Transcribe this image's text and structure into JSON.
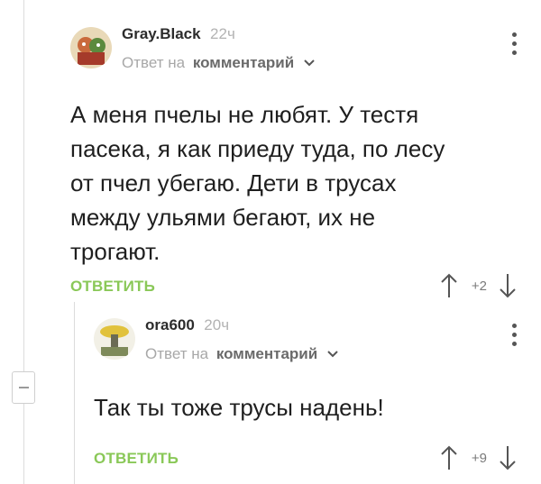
{
  "comments": [
    {
      "author": "Gray.Black",
      "time": "22ч",
      "reply_label": "Ответ на",
      "reply_link": "комментарий",
      "text": "А меня пчелы не любят. У тестя пасека, я как приеду туда, по лесу от пчел убегаю. Дети в трусах между ульями бегают, их не трогают.",
      "reply_button": "ОТВЕТИТЬ",
      "score": "+2"
    },
    {
      "author": "ora600",
      "time": "20ч",
      "reply_label": "Ответ на",
      "reply_link": "комментарий",
      "text": "Так ты тоже трусы надень!",
      "reply_button": "ОТВЕТИТЬ",
      "score": "+9"
    }
  ],
  "colors": {
    "accent_green": "#8ac858",
    "muted_text": "#a8a8a8",
    "thread_line": "#dcdcdc"
  },
  "icons": [
    "avatar",
    "chevron-down-icon",
    "more-vertical-icon",
    "arrow-up-icon",
    "arrow-down-icon",
    "collapse-icon"
  ]
}
